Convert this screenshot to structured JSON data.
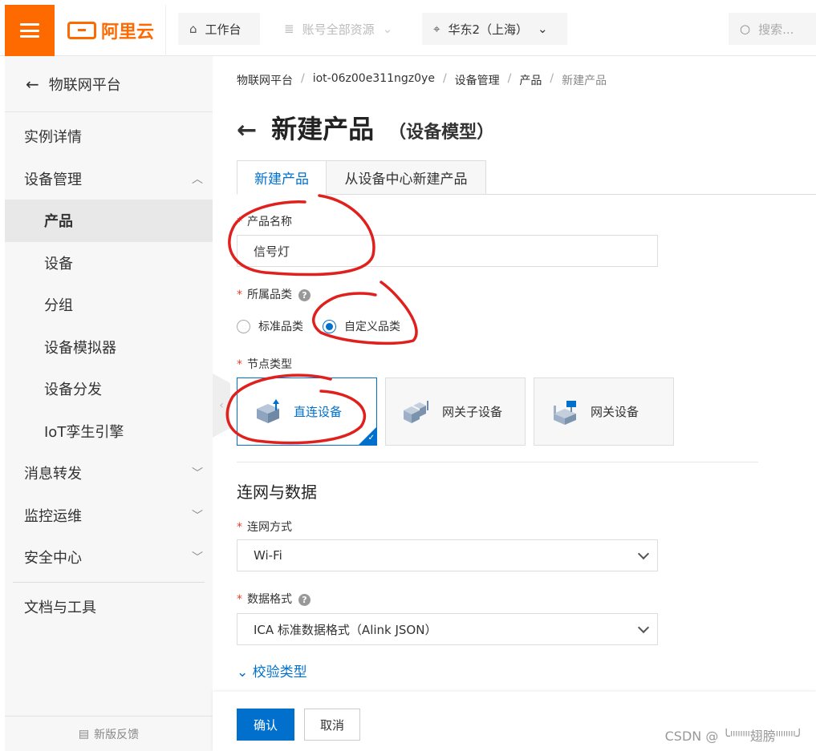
{
  "topbar": {
    "logo": "阿里云",
    "workbench": "工作台",
    "resources": "账号全部资源",
    "region": "华东2（上海）",
    "search_placeholder": "搜索..."
  },
  "sidebar": {
    "back_label": "物联网平台",
    "items": [
      {
        "label": "实例详情"
      },
      {
        "label": "设备管理"
      },
      {
        "label": "产品"
      },
      {
        "label": "设备"
      },
      {
        "label": "分组"
      },
      {
        "label": "设备模拟器"
      },
      {
        "label": "设备分发"
      },
      {
        "label": "IoT孪生引擎"
      },
      {
        "label": "消息转发"
      },
      {
        "label": "监控运维"
      },
      {
        "label": "安全中心"
      },
      {
        "label": "文档与工具"
      }
    ],
    "feedback": "新版反馈"
  },
  "breadcrumb": [
    "物联网平台",
    "iot-06z00e311ngz0ye",
    "设备管理",
    "产品",
    "新建产品"
  ],
  "page": {
    "title": "新建产品",
    "subtitle": "（设备模型）"
  },
  "tabs": [
    "新建产品",
    "从设备中心新建产品"
  ],
  "form": {
    "product_name_label": "产品名称",
    "product_name_value": "信号灯",
    "category_label": "所属品类",
    "category_options": [
      "标准品类",
      "自定义品类"
    ],
    "node_type_label": "节点类型",
    "node_types": [
      "直连设备",
      "网关子设备",
      "网关设备"
    ],
    "section_title": "连网与数据",
    "network_label": "连网方式",
    "network_value": "Wi-Fi",
    "data_format_label": "数据格式",
    "data_format_value": "ICA 标准数据格式（Alink JSON）",
    "verify_link": "校验类型"
  },
  "footer": {
    "confirm": "确认",
    "cancel": "取消"
  },
  "watermark": "CSDN @ ╰ᐦᐦᐦᐦ翅膀ᐦᐦᐦᐦ╯",
  "colors": {
    "brand": "#ff6a00",
    "primary": "#0070cc",
    "annotation": "#e0201c"
  }
}
